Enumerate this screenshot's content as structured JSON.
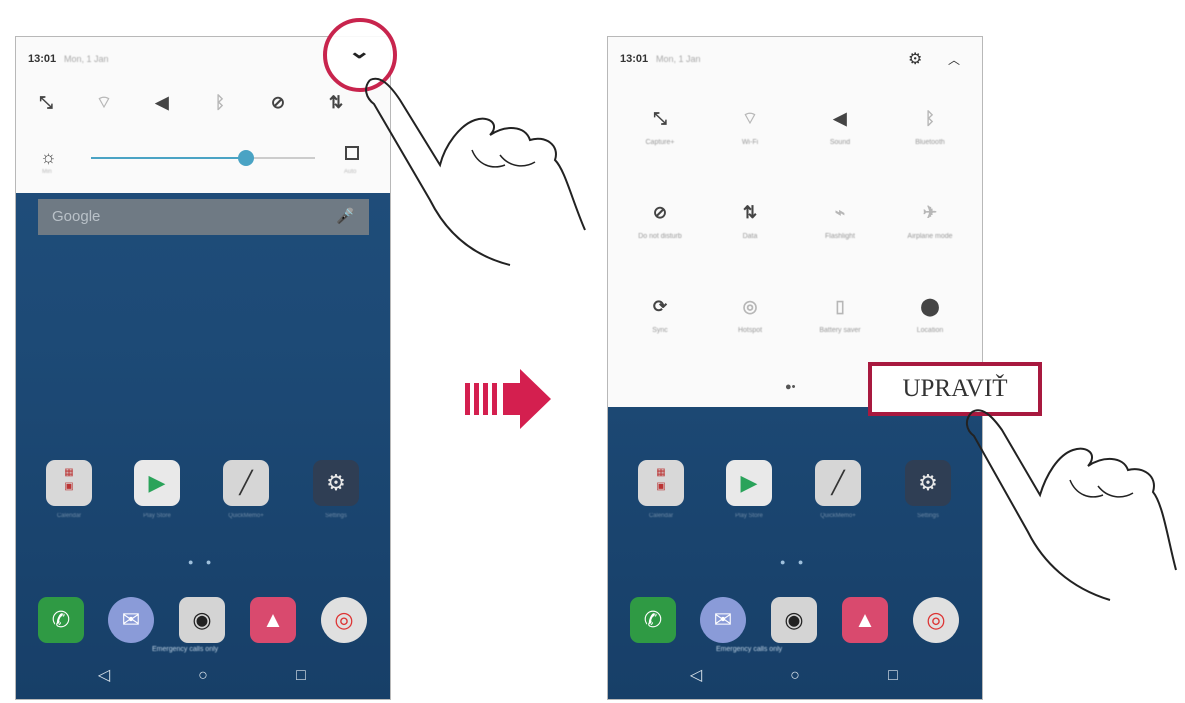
{
  "left_screen": {
    "status": {
      "time": "13:01",
      "date": "Mon, 1 Jan"
    },
    "quick_icons": [
      {
        "icon": "capture-icon",
        "glyph": "⤡",
        "dim": false
      },
      {
        "icon": "wifi-off-icon",
        "glyph": "⌔",
        "dim": true
      },
      {
        "icon": "sound-icon",
        "glyph": "◀",
        "dim": false
      },
      {
        "icon": "bluetooth-off-icon",
        "glyph": "ᛒ",
        "dim": true
      },
      {
        "icon": "do-not-disturb-icon",
        "glyph": "⊘",
        "dim": false
      },
      {
        "icon": "data-icon",
        "glyph": "⇅",
        "dim": false
      }
    ],
    "brightness": {
      "level": 0.69,
      "min_label": "Min",
      "auto_label": "Auto"
    },
    "search": {
      "text": "Google",
      "mic": "🎤"
    },
    "emergency": "Emergency calls only"
  },
  "right_screen": {
    "status": {
      "time": "13:01",
      "date": "Mon, 1 Jan"
    },
    "tiles": [
      {
        "label": "Capture+",
        "icon": "capture-icon",
        "glyph": "⤡",
        "dim": false
      },
      {
        "label": "Wi-Fi",
        "icon": "wifi-off-icon",
        "glyph": "⌔",
        "dim": true
      },
      {
        "label": "Sound",
        "icon": "sound-icon",
        "glyph": "◀",
        "dim": false
      },
      {
        "label": "Bluetooth",
        "icon": "bluetooth-off-icon",
        "glyph": "ᛒ",
        "dim": true
      },
      {
        "label": "Do not disturb",
        "icon": "do-not-disturb-icon",
        "glyph": "⊘",
        "dim": false
      },
      {
        "label": "Data",
        "icon": "data-icon",
        "glyph": "⇅",
        "dim": false
      },
      {
        "label": "Flashlight",
        "icon": "flashlight-off-icon",
        "glyph": "⌁",
        "dim": true
      },
      {
        "label": "Airplane mode",
        "icon": "airplane-off-icon",
        "glyph": "✈",
        "dim": true
      },
      {
        "label": "Sync",
        "icon": "sync-icon",
        "glyph": "⟳",
        "dim": false
      },
      {
        "label": "Hotspot",
        "icon": "hotspot-off-icon",
        "glyph": "◎",
        "dim": true
      },
      {
        "label": "Battery saver",
        "icon": "battery-saver-off-icon",
        "glyph": "▯",
        "dim": true
      },
      {
        "label": "Location",
        "icon": "location-icon",
        "glyph": "⬤",
        "dim": false
      }
    ],
    "emergency": "Emergency calls only"
  },
  "callout": {
    "edit_label": "UPRAVIŤ"
  },
  "colors": {
    "accent": "#c8244d",
    "arrow": "#d41f4f",
    "wallpaper": "#1f4d78",
    "slider": "#4aa3c4"
  }
}
